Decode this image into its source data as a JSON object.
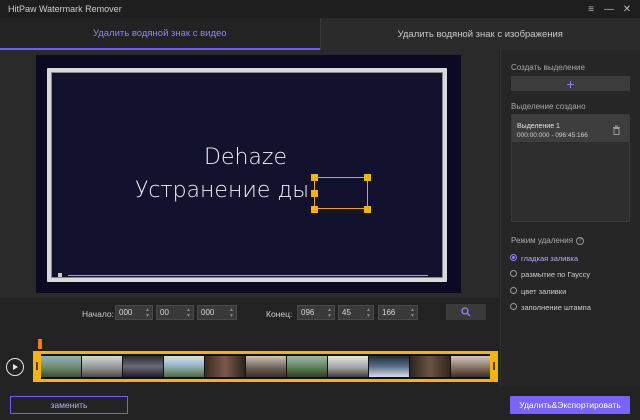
{
  "app": {
    "title": "HitPaw Watermark Remover",
    "window_buttons": {
      "menu": "≡",
      "minimize": "—",
      "close": "✕"
    }
  },
  "tabs": [
    {
      "label": "Удалить водяной знак с видео",
      "active": true
    },
    {
      "label": "Удалить водяной знак с изображения",
      "active": false
    }
  ],
  "preview": {
    "line1": "Dehaze",
    "line2": "Устранение ды"
  },
  "time": {
    "start_label": "Начало:",
    "start": [
      "000",
      "00",
      "000"
    ],
    "end_label": "Конец:",
    "end": [
      "096",
      "45",
      "166"
    ]
  },
  "panel": {
    "create_label": "Создать выделение",
    "add_symbol": "+",
    "created_label": "Выделение создано",
    "selection_name": "Выделение 1",
    "selection_time": "000:00:000 - 096:45:166",
    "mode_label": "Режим удаления",
    "help_symbol": "?",
    "modes": [
      {
        "label": "гладкая заливка",
        "selected": true
      },
      {
        "label": "размытие по Гауссу",
        "selected": false
      },
      {
        "label": "цвет заливки",
        "selected": false
      },
      {
        "label": "заполнение штампа",
        "selected": false
      }
    ]
  },
  "buttons": {
    "replace": "заменить",
    "export": "Удалить&Экспортировать"
  },
  "colors": {
    "accent": "#7a64ff",
    "selection": "#f5b400",
    "playhead": "#ff7a1a"
  }
}
